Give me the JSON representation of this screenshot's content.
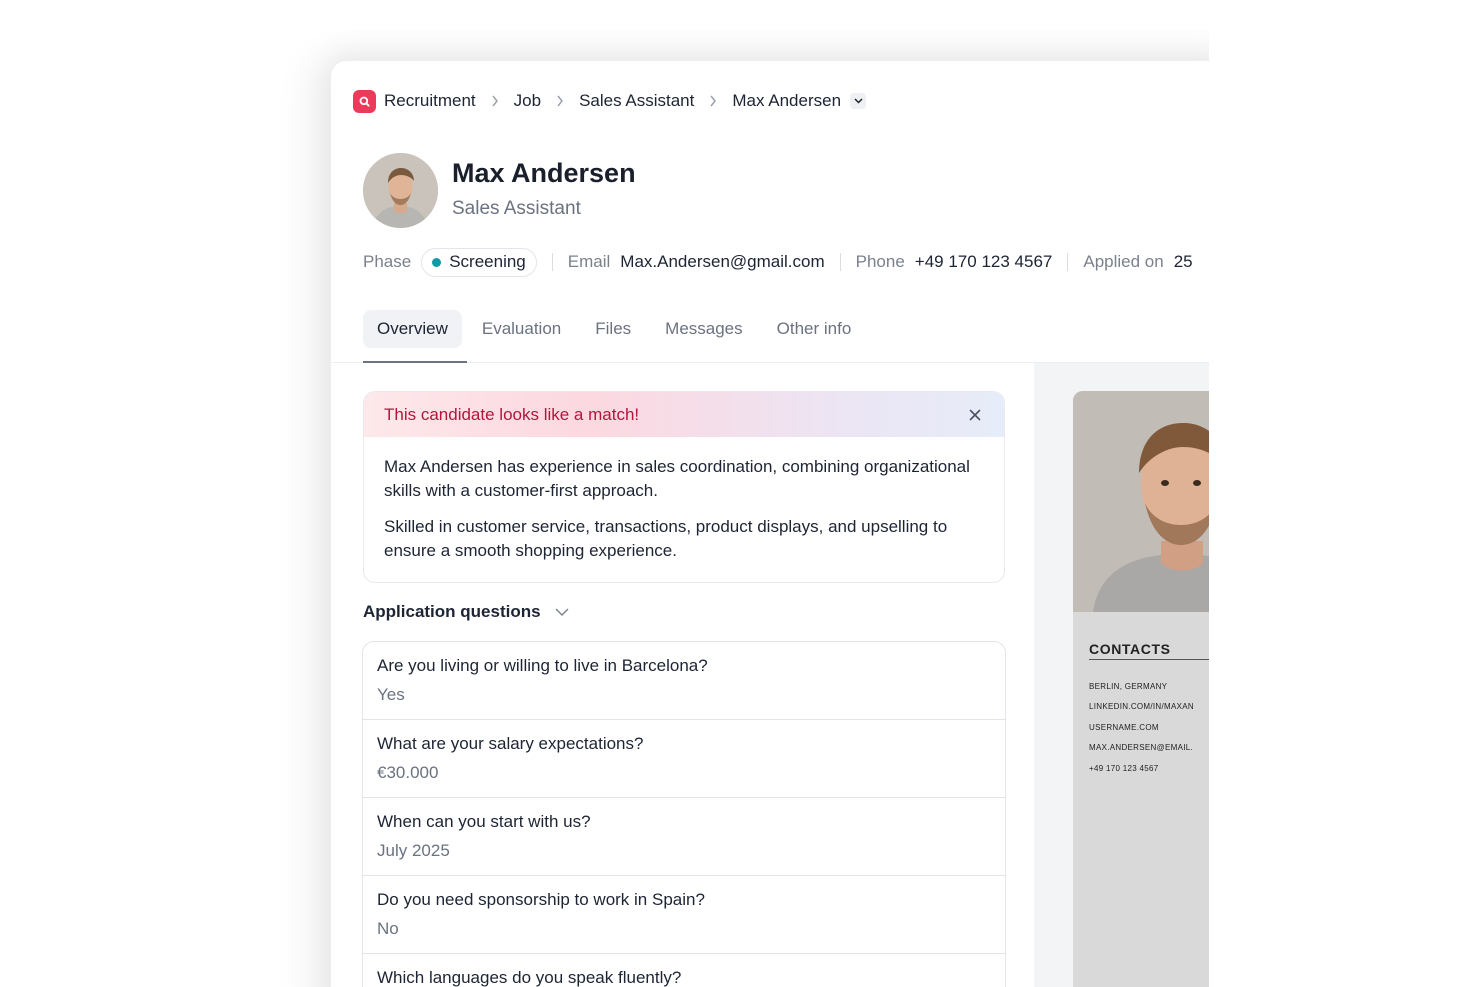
{
  "breadcrumb": {
    "items": [
      "Recruitment",
      "Job",
      "Sales Assistant",
      "Max Andersen"
    ]
  },
  "candidate": {
    "name": "Max Andersen",
    "role": "Sales Assistant"
  },
  "meta": {
    "phase_label": "Phase",
    "phase_value": "Screening",
    "phase_color": "#0e9aa7",
    "email_label": "Email",
    "email_value": "Max.Andersen@gmail.com",
    "phone_label": "Phone",
    "phone_value": "+49 170 123 4567",
    "applied_label": "Applied on",
    "applied_value": "25"
  },
  "tabs": [
    {
      "label": "Overview",
      "active": true
    },
    {
      "label": "Evaluation",
      "active": false
    },
    {
      "label": "Files",
      "active": false
    },
    {
      "label": "Messages",
      "active": false
    },
    {
      "label": "Other info",
      "active": false
    }
  ],
  "match": {
    "title": "This candidate looks like a match!",
    "paragraphs": [
      "Max Andersen has experience in sales coordination, combining organizational skills with a customer-first approach.",
      "Skilled in customer service, transactions, product displays, and upselling to ensure a smooth shopping experience."
    ]
  },
  "questions": {
    "title": "Application questions",
    "items": [
      {
        "q": "Are you living or willing to live in Barcelona?",
        "a": "Yes"
      },
      {
        "q": "What are your salary expectations?",
        "a": "€30.000"
      },
      {
        "q": "When can you start with us?",
        "a": "July 2025"
      },
      {
        "q": "Do you need sponsorship to work in Spain?",
        "a": "No"
      },
      {
        "q": "Which languages do you speak fluently?",
        "a": ""
      }
    ]
  },
  "resume": {
    "contacts_title": "CONTACTS",
    "lines": [
      "BERLIN, GERMANY",
      "LINKEDIN.COM/IN/MAXAN",
      "USERNAME.COM",
      "MAX.ANDERSEN@EMAIL.",
      "+49 170 123 4567"
    ]
  },
  "colors": {
    "brand": "#ec3b5a",
    "match_title": "#b3163b"
  }
}
